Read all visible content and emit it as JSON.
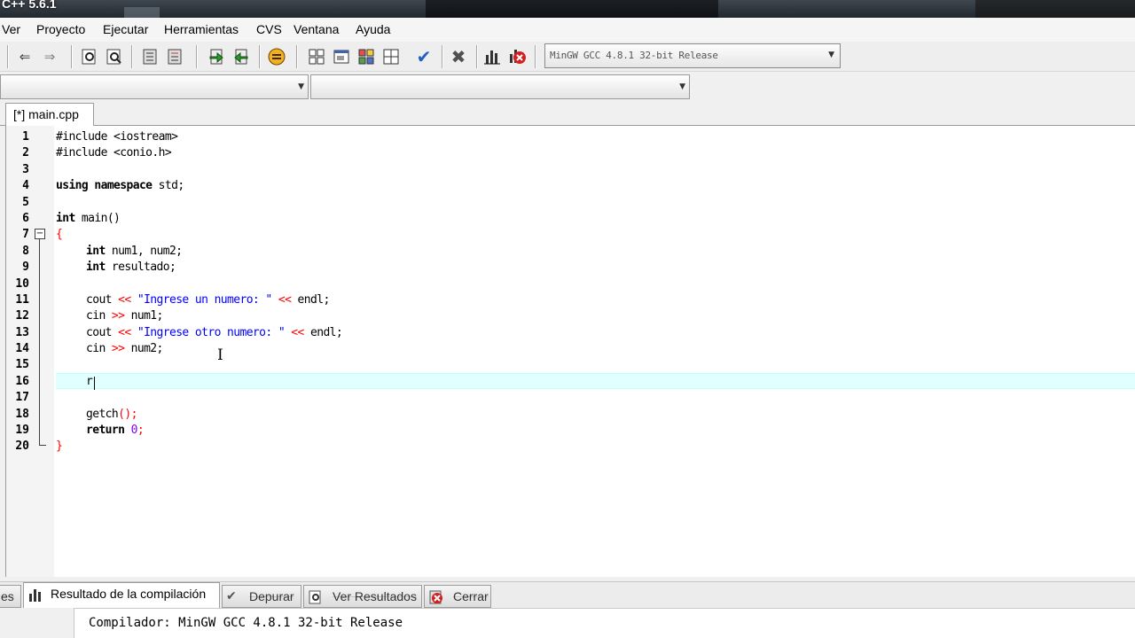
{
  "window": {
    "title": "C++ 5.6.1"
  },
  "menu": [
    "Ver",
    "Proyecto",
    "Ejecutar",
    "Herramientas",
    "CVS",
    "Ventana",
    "Ayuda"
  ],
  "toolbar": {
    "compiler_selected": "MinGW GCC 4.8.1 32-bit Release",
    "icons": [
      "undo-icon",
      "redo-icon",
      "find-icon",
      "replace-icon",
      "indent-icon",
      "unindent-icon",
      "goto-icon",
      "bookmark-icon",
      "debug-icon",
      "new-class-icon",
      "new-window-icon",
      "tile-icon",
      "arrange-icon",
      "check-syntax-icon",
      "stop-icon",
      "chart-icon",
      "profile-delete-icon"
    ]
  },
  "editor": {
    "tab_label": "[*] main.cpp",
    "lines": [
      "1",
      "2",
      "3",
      "4",
      "5",
      "6",
      "7",
      "8",
      "9",
      "10",
      "11",
      "12",
      "13",
      "14",
      "15",
      "16",
      "17",
      "18",
      "19",
      "20"
    ],
    "code": {
      "l1": "#include <iostream>",
      "l2": "#include <conio.h>",
      "l4a": "using namespace",
      "l4b": " std;",
      "l6a": "int",
      "l6b": " main()",
      "l7": "{",
      "l8a": "int",
      "l8b": " num1, num2;",
      "l9a": "int",
      "l9b": " resultado;",
      "l11a": "cout ",
      "l11b": "<<",
      "l11c": "\"Ingrese un numero: \"",
      "l11d": "<<",
      "l11e": " endl;",
      "l12a": "cin ",
      "l12b": ">>",
      "l12c": " num1;",
      "l13a": "cout ",
      "l13b": "<<",
      "l13c": "\"Ingrese otro numero: \"",
      "l13d": "<<",
      "l13e": " endl;",
      "l14a": "cin ",
      "l14b": ">>",
      "l14c": " num2;",
      "l16": "r",
      "l18a": "getch",
      "l18b": "();",
      "l19a": "return ",
      "l19b": "0",
      "l19c": ";",
      "l20": "}"
    }
  },
  "bottom": {
    "tabs": [
      {
        "label": "es",
        "icon": ""
      },
      {
        "label": "Resultado de la compilación",
        "icon": "chart-icon"
      },
      {
        "label": "Depurar",
        "icon": "check-icon"
      },
      {
        "label": "Ver Resultados",
        "icon": "search-icon"
      },
      {
        "label": "Cerrar",
        "icon": "close-icon"
      }
    ],
    "output_lines": [
      "Compilador: MinGW GCC 4.8.1 32-bit Release"
    ]
  },
  "colors": {
    "keyword": "#000000",
    "string": "#0000ff",
    "operator": "#ff0000",
    "number": "#8000ff",
    "current_line": "#e0ffff"
  }
}
